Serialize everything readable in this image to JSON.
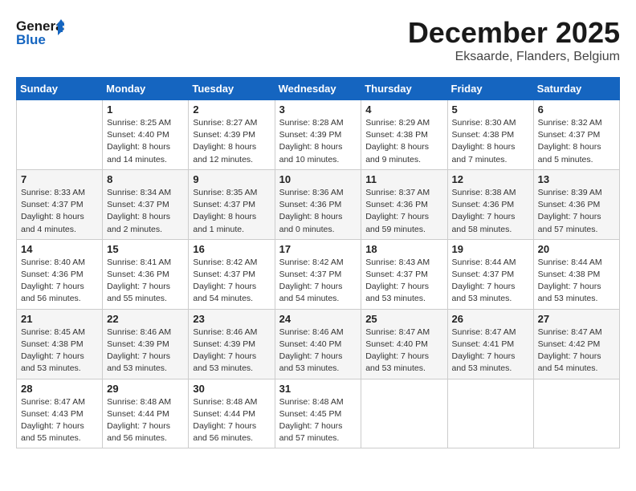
{
  "header": {
    "logo_line1": "General",
    "logo_line2": "Blue",
    "month": "December 2025",
    "location": "Eksaarde, Flanders, Belgium"
  },
  "weekdays": [
    "Sunday",
    "Monday",
    "Tuesday",
    "Wednesday",
    "Thursday",
    "Friday",
    "Saturday"
  ],
  "weeks": [
    [
      {
        "day": "",
        "detail": ""
      },
      {
        "day": "1",
        "detail": "Sunrise: 8:25 AM\nSunset: 4:40 PM\nDaylight: 8 hours\nand 14 minutes."
      },
      {
        "day": "2",
        "detail": "Sunrise: 8:27 AM\nSunset: 4:39 PM\nDaylight: 8 hours\nand 12 minutes."
      },
      {
        "day": "3",
        "detail": "Sunrise: 8:28 AM\nSunset: 4:39 PM\nDaylight: 8 hours\nand 10 minutes."
      },
      {
        "day": "4",
        "detail": "Sunrise: 8:29 AM\nSunset: 4:38 PM\nDaylight: 8 hours\nand 9 minutes."
      },
      {
        "day": "5",
        "detail": "Sunrise: 8:30 AM\nSunset: 4:38 PM\nDaylight: 8 hours\nand 7 minutes."
      },
      {
        "day": "6",
        "detail": "Sunrise: 8:32 AM\nSunset: 4:37 PM\nDaylight: 8 hours\nand 5 minutes."
      }
    ],
    [
      {
        "day": "7",
        "detail": "Sunrise: 8:33 AM\nSunset: 4:37 PM\nDaylight: 8 hours\nand 4 minutes."
      },
      {
        "day": "8",
        "detail": "Sunrise: 8:34 AM\nSunset: 4:37 PM\nDaylight: 8 hours\nand 2 minutes."
      },
      {
        "day": "9",
        "detail": "Sunrise: 8:35 AM\nSunset: 4:37 PM\nDaylight: 8 hours\nand 1 minute."
      },
      {
        "day": "10",
        "detail": "Sunrise: 8:36 AM\nSunset: 4:36 PM\nDaylight: 8 hours\nand 0 minutes."
      },
      {
        "day": "11",
        "detail": "Sunrise: 8:37 AM\nSunset: 4:36 PM\nDaylight: 7 hours\nand 59 minutes."
      },
      {
        "day": "12",
        "detail": "Sunrise: 8:38 AM\nSunset: 4:36 PM\nDaylight: 7 hours\nand 58 minutes."
      },
      {
        "day": "13",
        "detail": "Sunrise: 8:39 AM\nSunset: 4:36 PM\nDaylight: 7 hours\nand 57 minutes."
      }
    ],
    [
      {
        "day": "14",
        "detail": "Sunrise: 8:40 AM\nSunset: 4:36 PM\nDaylight: 7 hours\nand 56 minutes."
      },
      {
        "day": "15",
        "detail": "Sunrise: 8:41 AM\nSunset: 4:36 PM\nDaylight: 7 hours\nand 55 minutes."
      },
      {
        "day": "16",
        "detail": "Sunrise: 8:42 AM\nSunset: 4:37 PM\nDaylight: 7 hours\nand 54 minutes."
      },
      {
        "day": "17",
        "detail": "Sunrise: 8:42 AM\nSunset: 4:37 PM\nDaylight: 7 hours\nand 54 minutes."
      },
      {
        "day": "18",
        "detail": "Sunrise: 8:43 AM\nSunset: 4:37 PM\nDaylight: 7 hours\nand 53 minutes."
      },
      {
        "day": "19",
        "detail": "Sunrise: 8:44 AM\nSunset: 4:37 PM\nDaylight: 7 hours\nand 53 minutes."
      },
      {
        "day": "20",
        "detail": "Sunrise: 8:44 AM\nSunset: 4:38 PM\nDaylight: 7 hours\nand 53 minutes."
      }
    ],
    [
      {
        "day": "21",
        "detail": "Sunrise: 8:45 AM\nSunset: 4:38 PM\nDaylight: 7 hours\nand 53 minutes."
      },
      {
        "day": "22",
        "detail": "Sunrise: 8:46 AM\nSunset: 4:39 PM\nDaylight: 7 hours\nand 53 minutes."
      },
      {
        "day": "23",
        "detail": "Sunrise: 8:46 AM\nSunset: 4:39 PM\nDaylight: 7 hours\nand 53 minutes."
      },
      {
        "day": "24",
        "detail": "Sunrise: 8:46 AM\nSunset: 4:40 PM\nDaylight: 7 hours\nand 53 minutes."
      },
      {
        "day": "25",
        "detail": "Sunrise: 8:47 AM\nSunset: 4:40 PM\nDaylight: 7 hours\nand 53 minutes."
      },
      {
        "day": "26",
        "detail": "Sunrise: 8:47 AM\nSunset: 4:41 PM\nDaylight: 7 hours\nand 53 minutes."
      },
      {
        "day": "27",
        "detail": "Sunrise: 8:47 AM\nSunset: 4:42 PM\nDaylight: 7 hours\nand 54 minutes."
      }
    ],
    [
      {
        "day": "28",
        "detail": "Sunrise: 8:47 AM\nSunset: 4:43 PM\nDaylight: 7 hours\nand 55 minutes."
      },
      {
        "day": "29",
        "detail": "Sunrise: 8:48 AM\nSunset: 4:44 PM\nDaylight: 7 hours\nand 56 minutes."
      },
      {
        "day": "30",
        "detail": "Sunrise: 8:48 AM\nSunset: 4:44 PM\nDaylight: 7 hours\nand 56 minutes."
      },
      {
        "day": "31",
        "detail": "Sunrise: 8:48 AM\nSunset: 4:45 PM\nDaylight: 7 hours\nand 57 minutes."
      },
      {
        "day": "",
        "detail": ""
      },
      {
        "day": "",
        "detail": ""
      },
      {
        "day": "",
        "detail": ""
      }
    ]
  ]
}
